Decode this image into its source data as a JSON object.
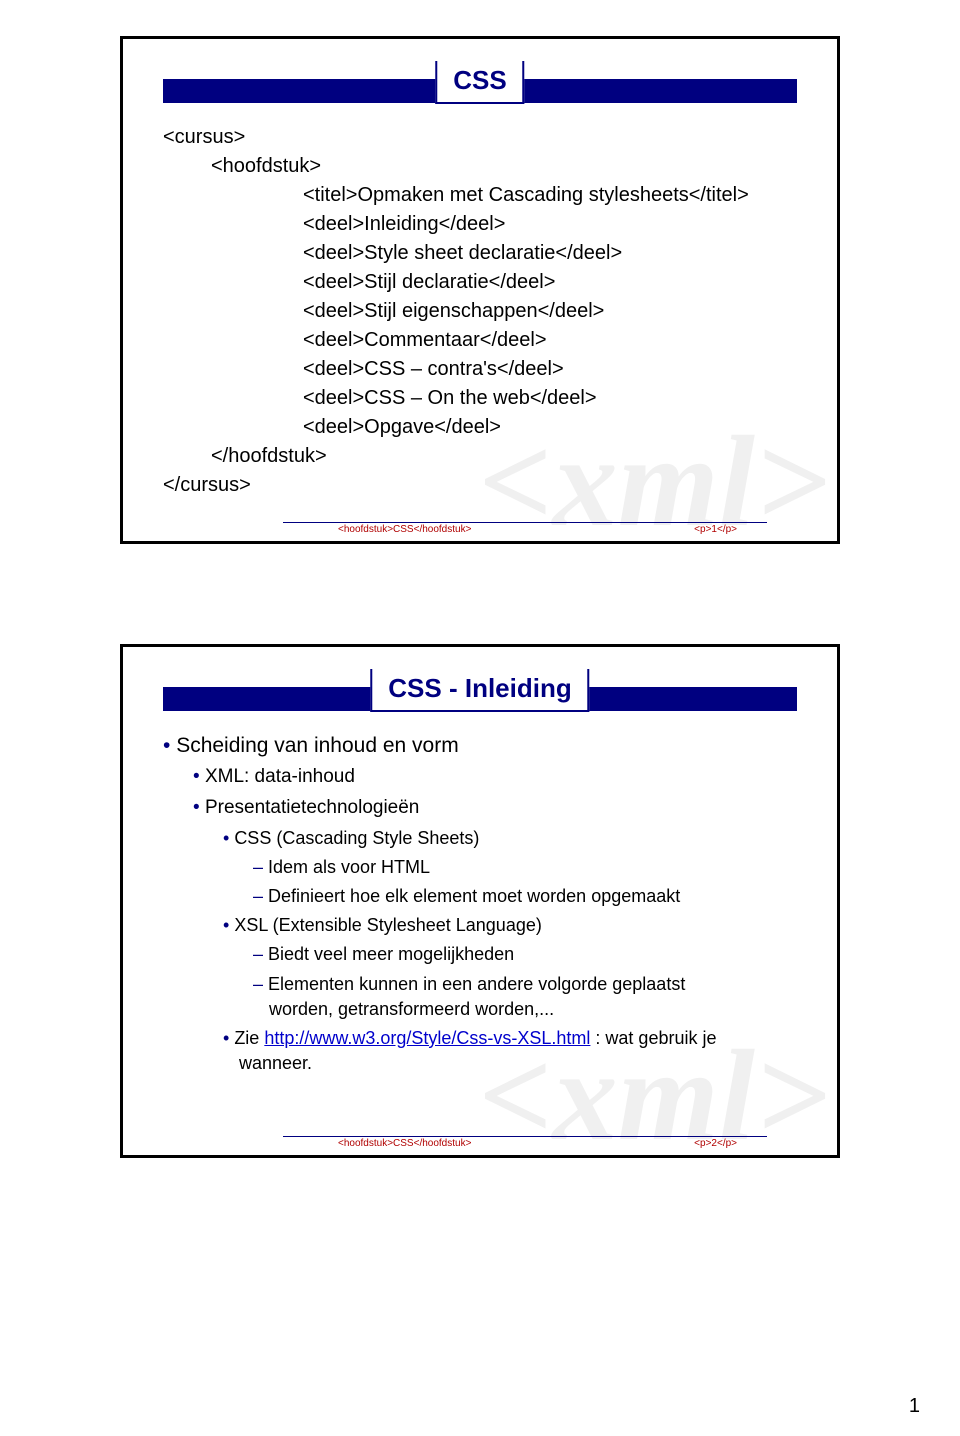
{
  "pageNumber": "1",
  "slide1": {
    "title": "CSS",
    "lines": [
      "<cursus>",
      "<hoofdstuk>",
      "<titel>Opmaken met Cascading stylesheets</titel>",
      "<deel>Inleiding</deel>",
      "<deel>Style sheet declaratie</deel>",
      "<deel>Stijl declaratie</deel>",
      "<deel>Stijl eigenschappen</deel>",
      "<deel>Commentaar</deel>",
      "<deel>CSS – contra's</deel>",
      "<deel>CSS – On the web</deel>",
      "<deel>Opgave</deel>",
      "</hoofdstuk>",
      "</cursus>"
    ],
    "footer_left": "<hoofdstuk>CSS</hoofdstuk>",
    "footer_right": "<p>1</p>"
  },
  "slide2": {
    "title": "CSS - Inleiding",
    "b0": "Scheiding van inhoud en vorm",
    "b1a": "XML: data-inhoud",
    "b1b": "Presentatietechnologieën",
    "b2a": "CSS (Cascading Style Sheets)",
    "b3a": "Idem als voor HTML",
    "b3b": "Definieert hoe elk element moet worden opgemaakt",
    "b2b": "XSL (Extensible Stylesheet Language)",
    "b3c": "Biedt veel meer mogelijkheden",
    "b3d": "Elementen kunnen in een andere volgorde geplaatst",
    "b3d2": "worden, getransformeerd worden,...",
    "b2c_pre": "Zie ",
    "b2c_link": "http://www.w3.org/Style/Css-vs-XSL.html",
    "b2c_post": " : wat gebruik je",
    "b2c_cont": "wanneer.",
    "footer_left": "<hoofdstuk>CSS</hoofdstuk>",
    "footer_right": "<p>2</p>"
  }
}
